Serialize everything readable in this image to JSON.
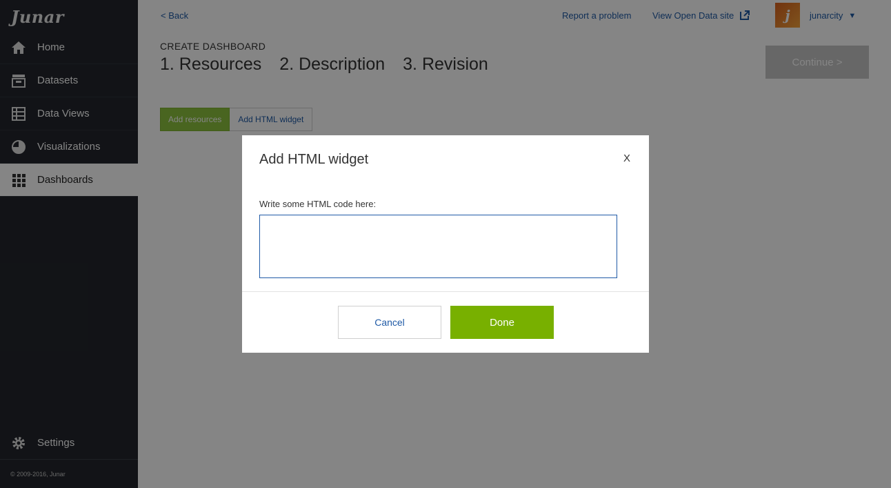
{
  "brand": {
    "logo_text": "Junar"
  },
  "sidebar": {
    "items": [
      {
        "label": "Home",
        "icon": "home-icon"
      },
      {
        "label": "Datasets",
        "icon": "datasets-icon"
      },
      {
        "label": "Data Views",
        "icon": "table-icon"
      },
      {
        "label": "Visualizations",
        "icon": "pie-chart-icon"
      },
      {
        "label": "Dashboards",
        "icon": "grid-icon",
        "active": true
      }
    ],
    "settings_label": "Settings",
    "copyright": "© 2009-2016, Junar"
  },
  "header": {
    "back_label": "< Back",
    "report_label": "Report a problem",
    "open_data_label": "View Open Data site",
    "username": "junarcity",
    "caret": "▼",
    "avatar_letter": "j"
  },
  "page": {
    "create_title": "CREATE DASHBOARD",
    "steps": [
      "1. Resources",
      "2. Description",
      "3. Revision"
    ],
    "continue_label": "Continue >",
    "tabs": {
      "add_resources": "Add resources",
      "add_html": "Add HTML widget"
    }
  },
  "modal": {
    "title": "Add HTML widget",
    "close_label": "X",
    "field_label": "Write some HTML code here:",
    "field_value": "",
    "cancel_label": "Cancel",
    "done_label": "Done"
  },
  "colors": {
    "sidebar_bg": "#23262c",
    "accent_green": "#78b000",
    "link_blue": "#1f5aa6"
  }
}
